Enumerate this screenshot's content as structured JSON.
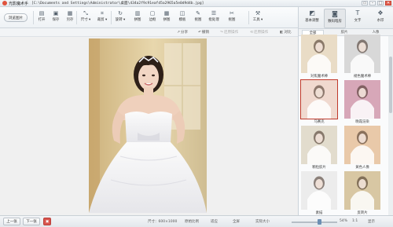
{
  "window": {
    "app_name": "光影魔术手",
    "file_path": "[C:\\Documents and Settings\\Administrator\\桌面\\434a2f9c91eafd5a2965a5e0d9d4b.jpg]",
    "controls": [
      "▭",
      "–",
      "□",
      "✕"
    ]
  },
  "toolbar": {
    "browse_label": "浏览图片",
    "tools": [
      {
        "label": "打开",
        "icon": "open-folder-icon",
        "glyph": "▤"
      },
      {
        "label": "保存",
        "icon": "save-icon",
        "glyph": "▣"
      },
      {
        "label": "另存",
        "icon": "save-as-icon",
        "glyph": "▦"
      },
      {
        "label": "尺寸 ▾",
        "icon": "resize-icon",
        "glyph": "⤡"
      },
      {
        "label": "裁剪 ▾",
        "icon": "crop-icon",
        "glyph": "⌗"
      },
      {
        "label": "旋转 ▾",
        "icon": "rotate-icon",
        "glyph": "↻"
      },
      {
        "label": "拼图",
        "icon": "collage-icon",
        "glyph": "▥"
      },
      {
        "label": "边框",
        "icon": "frame-icon",
        "glyph": "▢"
      },
      {
        "label": "拼图",
        "icon": "puzzle-icon",
        "glyph": "▦"
      },
      {
        "label": "模板",
        "icon": "template-icon",
        "glyph": "◫"
      },
      {
        "label": "抠图",
        "icon": "cutout-icon",
        "glyph": "✎"
      },
      {
        "label": "批处理",
        "icon": "batch-icon",
        "glyph": "☰"
      },
      {
        "label": "抠图",
        "icon": "matting-icon",
        "glyph": "✂"
      },
      {
        "label": "工具 ▾",
        "icon": "tools-icon",
        "glyph": "⚒"
      }
    ]
  },
  "subbar": {
    "share": "分享",
    "undo": "撤销",
    "redo": "还原操作",
    "restore": "还原操作",
    "compare": "对比"
  },
  "right_panel": {
    "tabs": [
      {
        "label": "基本调整",
        "icon": "adjust-icon",
        "glyph": "◩"
      },
      {
        "label": "数码暗房",
        "icon": "darkroom-icon",
        "glyph": "◙"
      },
      {
        "label": "文字",
        "icon": "text-icon",
        "glyph": "T"
      },
      {
        "label": "水印",
        "icon": "watermark-icon",
        "glyph": "❖"
      }
    ],
    "categories": [
      "全部",
      "胶片",
      "人像"
    ],
    "effects": [
      {
        "label": "对焦魔术棒"
      },
      {
        "label": "褪色魔术棒"
      },
      {
        "label": "马赛克"
      },
      {
        "label": "晚霞渲染"
      },
      {
        "label": "颗粒胶片"
      },
      {
        "label": "黄色人像"
      },
      {
        "label": "素描"
      },
      {
        "label": "反转片"
      }
    ]
  },
  "statusbar": {
    "prev": "上一张",
    "next": "下一张",
    "delete_icon": "▣",
    "size": "尺寸：600×1000",
    "original": "原始比例",
    "fit": "适应",
    "fullscreen": "全屏",
    "realsize": "实际大小",
    "zoom_percent": 54,
    "zoom": "54%",
    "zoom_ratio": "1:1",
    "more": "显示"
  },
  "colors": {
    "accent": "#6c8fb3",
    "delete": "#d9544d",
    "selected_outline": "#c0392b"
  }
}
